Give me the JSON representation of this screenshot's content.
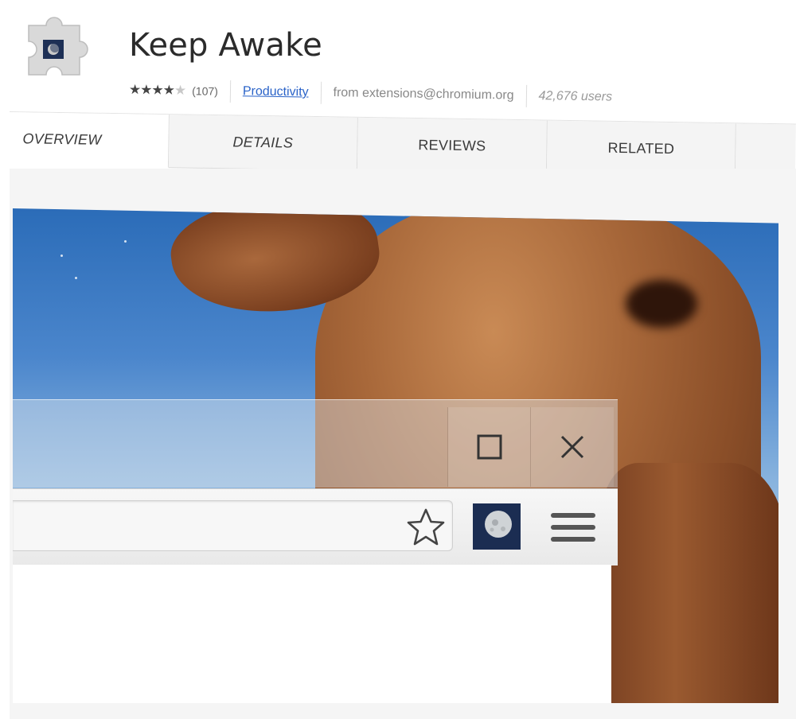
{
  "extension": {
    "name": "Keep Awake",
    "icon": "puzzle-piece-icon",
    "rating": 4,
    "rating_max": 5,
    "rating_stars": "★★★★",
    "rating_stars_off": "★",
    "review_count": "(107)",
    "category": "Productivity",
    "source": "from extensions@chromium.org",
    "users": "42,676 users"
  },
  "tabs": [
    {
      "label": "OVERVIEW",
      "active": true
    },
    {
      "label": "DETAILS",
      "active": false
    },
    {
      "label": "REVIEWS",
      "active": false
    },
    {
      "label": "RELATED",
      "active": false
    }
  ],
  "screenshot": {
    "icons": {
      "maximize": "maximize-icon",
      "close": "close-icon",
      "bookmark": "star-outline-icon",
      "extension": "moon-icon",
      "menu": "hamburger-menu-icon"
    }
  },
  "colors": {
    "link": "#2962c8",
    "sky": "#4b86cc",
    "rock": "#a8683a"
  }
}
